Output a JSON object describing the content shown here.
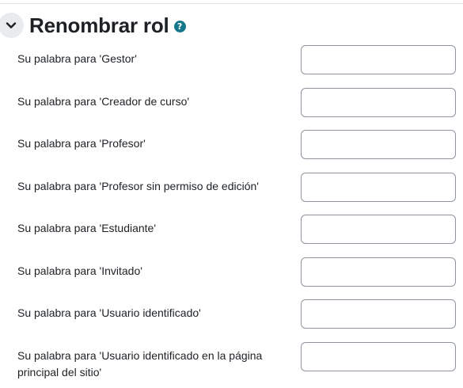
{
  "section": {
    "title": "Renombrar rol",
    "toggle_icon": "chevron-down-icon",
    "help_icon": "question-circle-icon",
    "help_glyph": "?",
    "help_color": "#14788a"
  },
  "fields": [
    {
      "label": "Su palabra para 'Gestor'",
      "value": ""
    },
    {
      "label": "Su palabra para 'Creador de curso'",
      "value": ""
    },
    {
      "label": "Su palabra para 'Profesor'",
      "value": ""
    },
    {
      "label": "Su palabra para 'Profesor sin permiso de edición'",
      "value": ""
    },
    {
      "label": "Su palabra para 'Estudiante'",
      "value": ""
    },
    {
      "label": "Su palabra para 'Invitado'",
      "value": ""
    },
    {
      "label": "Su palabra para 'Usuario identificado'",
      "value": ""
    },
    {
      "label": "Su palabra para 'Usuario identificado en la página principal del sitio'",
      "value": ""
    }
  ]
}
